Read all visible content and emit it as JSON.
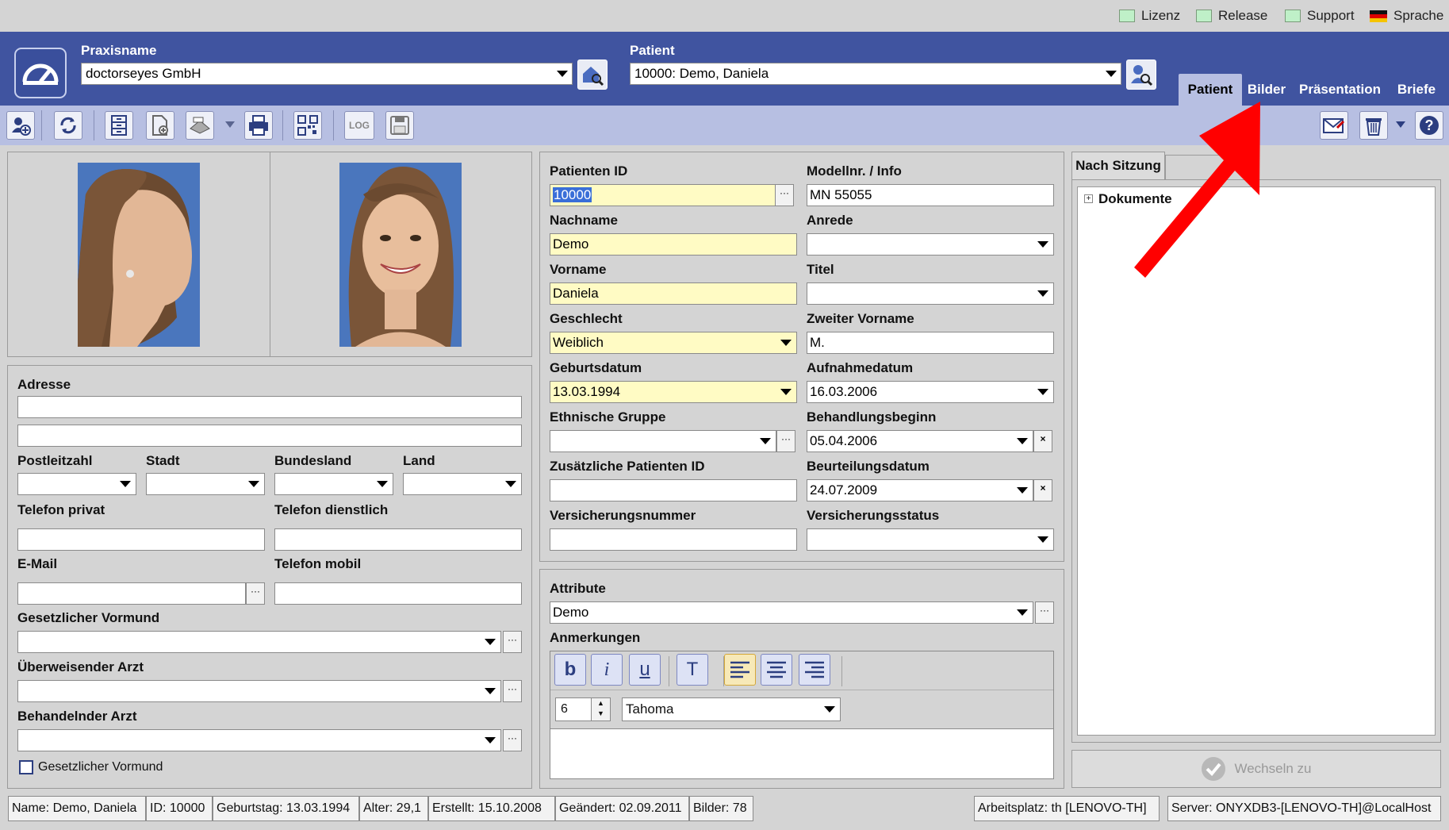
{
  "top_links": {
    "lizenz": "Lizenz",
    "release": "Release",
    "support": "Support",
    "sprache": "Sprache"
  },
  "header": {
    "praxis_label": "Praxisname",
    "praxis_value": "doctorseyes GmbH",
    "patient_label": "Patient",
    "patient_value": "10000: Demo, Daniela",
    "tabs": [
      "Patient",
      "Bilder",
      "Präsentation",
      "Briefe"
    ]
  },
  "toolbar": {
    "log_label": "LOG"
  },
  "form": {
    "patienten_id_label": "Patienten ID",
    "patienten_id": "10000",
    "modell_label": "Modellnr. / Info",
    "modell": "MN 55055",
    "nachname_label": "Nachname",
    "nachname": "Demo",
    "anrede_label": "Anrede",
    "anrede": "",
    "vorname_label": "Vorname",
    "vorname": "Daniela",
    "titel_label": "Titel",
    "titel": "",
    "geschlecht_label": "Geschlecht",
    "geschlecht": "Weiblich",
    "zweiter_label": "Zweiter Vorname",
    "zweiter": "M.",
    "geburt_label": "Geburtsdatum",
    "geburt": "13.03.1994",
    "aufnahme_label": "Aufnahmedatum",
    "aufnahme": "16.03.2006",
    "ethn_label": "Ethnische Gruppe",
    "ethn": "",
    "beh_label": "Behandlungsbeginn",
    "beh": "05.04.2006",
    "zus_label": "Zusätzliche Patienten ID",
    "zus": "",
    "beurt_label": "Beurteilungsdatum",
    "beurt": "24.07.2009",
    "vers_label": "Versicherungsnummer",
    "vers": "",
    "versstat_label": "Versicherungsstatus",
    "versstat": ""
  },
  "address": {
    "adresse_label": "Adresse",
    "plz_label": "Postleitzahl",
    "stadt_label": "Stadt",
    "bundesland_label": "Bundesland",
    "land_label": "Land",
    "tel_privat_label": "Telefon privat",
    "tel_dienst_label": "Telefon dienstlich",
    "email_label": "E-Mail",
    "tel_mobil_label": "Telefon mobil",
    "vormund_label": "Gesetzlicher Vormund",
    "ueberw_label": "Überweisender Arzt",
    "behandelnd_label": "Behandelnder Arzt",
    "vormund_check_label": "Gesetzlicher Vormund"
  },
  "notes": {
    "attribute_label": "Attribute",
    "attribute_value": "Demo",
    "anmerkungen_label": "Anmerkungen",
    "font_size": "6",
    "font_name": "Tahoma",
    "bold": "b",
    "italic": "i",
    "underline": "u",
    "textcolor": "T"
  },
  "right": {
    "tab_session": "Nach Sitzung",
    "tree_root": "Dokumente",
    "switch_button": "Wechseln zu"
  },
  "statusbar": [
    "Name: Demo, Daniela",
    "ID: 10000",
    "Geburtstag: 13.03.1994",
    "Alter: 29,1",
    "Erstellt: 15.10.2008",
    "Geändert: 02.09.2011",
    "Bilder: 78"
  ],
  "status_workplace": "Arbeitsplatz: th [LENOVO-TH]",
  "status_server": "Server: ONYXDB3-[LENOVO-TH]@LocalHost",
  "colors": {
    "header": "#4054a0",
    "toolbar": "#b7bfe2",
    "required_field": "#fffbc4",
    "arrow": "#ff0000"
  }
}
